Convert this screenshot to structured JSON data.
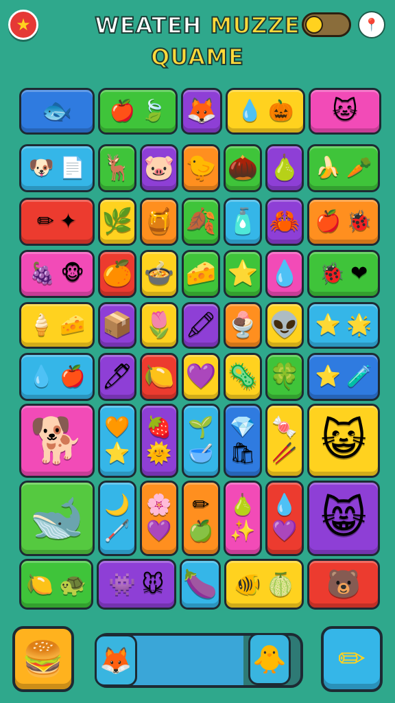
{
  "header": {
    "title_line1_part1": "WEATEH",
    "title_line1_part2": "MUZZE",
    "title_line2": "QUAME",
    "star_icon": "★",
    "pin_icon": "📍",
    "toggle_on": false
  },
  "palette": {
    "background": "#2fa88c",
    "blue": "#2f7be0",
    "green": "#3fc43a",
    "purple": "#8e3fd6",
    "yellow": "#ffd21f",
    "pink": "#f24bb7",
    "sky": "#35b6e8",
    "orange": "#ff8f1f",
    "red": "#ec3b2f",
    "lime": "#55c940"
  },
  "tiles": [
    {
      "name": "tile-robot-fish",
      "color": "blue",
      "items": [
        "🐟"
      ]
    },
    {
      "name": "tile-apple-leaf",
      "color": "green",
      "items": [
        "🍎",
        "🍃"
      ]
    },
    {
      "name": "tile-fox",
      "color": "purple",
      "items": [
        "🦊"
      ]
    },
    {
      "name": "tile-drop-pumpkin",
      "color": "yellow",
      "items": [
        "💧",
        "🎃"
      ]
    },
    {
      "name": "tile-cat",
      "color": "pink",
      "items": [
        "🐱"
      ]
    },
    {
      "name": "tile-dog-paper",
      "color": "sky",
      "items": [
        "🐶",
        "📄"
      ]
    },
    {
      "name": "tile-deer",
      "color": "green",
      "items": [
        "🦌"
      ]
    },
    {
      "name": "tile-pig",
      "color": "purple",
      "items": [
        "🐷"
      ]
    },
    {
      "name": "tile-chick",
      "color": "orange",
      "items": [
        "🐤"
      ]
    },
    {
      "name": "tile-pinecone",
      "color": "green",
      "items": [
        "🌰"
      ]
    },
    {
      "name": "tile-pear",
      "color": "purple",
      "items": [
        "🍐"
      ]
    },
    {
      "name": "tile-banana-carrot",
      "color": "green",
      "items": [
        "🍌",
        "🥕"
      ]
    },
    {
      "name": "tile-pencil-star",
      "color": "red",
      "items": [
        "✏",
        "✦"
      ]
    },
    {
      "name": "tile-herb",
      "color": "yellow",
      "items": [
        "🌿"
      ]
    },
    {
      "name": "tile-jar",
      "color": "orange",
      "items": [
        "🍯"
      ]
    },
    {
      "name": "tile-leaf",
      "color": "green",
      "items": [
        "🍂"
      ]
    },
    {
      "name": "tile-bottle",
      "color": "sky",
      "items": [
        "🧴"
      ]
    },
    {
      "name": "tile-crab",
      "color": "purple",
      "items": [
        "🦀"
      ]
    },
    {
      "name": "tile-apple-bug",
      "color": "orange",
      "items": [
        "🍎",
        "🐞"
      ]
    },
    {
      "name": "tile-grape-monkey",
      "color": "pink",
      "items": [
        "🍇",
        "🐵"
      ]
    },
    {
      "name": "tile-orange",
      "color": "red",
      "items": [
        "🍊"
      ]
    },
    {
      "name": "tile-pot",
      "color": "yellow",
      "items": [
        "🍲"
      ]
    },
    {
      "name": "tile-cheese",
      "color": "green",
      "items": [
        "🧀"
      ]
    },
    {
      "name": "tile-starfish",
      "color": "green",
      "items": [
        "⭐"
      ]
    },
    {
      "name": "tile-drop-purple",
      "color": "pink",
      "items": [
        "💧"
      ]
    },
    {
      "name": "tile-bug-heart",
      "color": "green",
      "items": [
        "🐞",
        "❤"
      ]
    },
    {
      "name": "tile-cone-cheese",
      "color": "yellow",
      "items": [
        "🍦",
        "🧀"
      ]
    },
    {
      "name": "tile-box",
      "color": "purple",
      "items": [
        "📦"
      ]
    },
    {
      "name": "tile-flowerpot",
      "color": "yellow",
      "items": [
        "🌷"
      ]
    },
    {
      "name": "tile-crayon",
      "color": "purple",
      "items": [
        "🖍"
      ]
    },
    {
      "name": "tile-cone",
      "color": "orange",
      "items": [
        "🍨"
      ]
    },
    {
      "name": "tile-alien",
      "color": "yellow",
      "items": [
        "👽"
      ]
    },
    {
      "name": "tile-stars",
      "color": "sky",
      "items": [
        "⭐",
        "🌟"
      ]
    },
    {
      "name": "tile-drop-apple",
      "color": "sky",
      "items": [
        "💧",
        "🍎"
      ]
    },
    {
      "name": "tile-marker",
      "color": "purple",
      "items": [
        "🖊"
      ]
    },
    {
      "name": "tile-lemon",
      "color": "red",
      "items": [
        "🍋"
      ]
    },
    {
      "name": "tile-heart-gem",
      "color": "yellow",
      "items": [
        "💜"
      ]
    },
    {
      "name": "tile-germ",
      "color": "yellow",
      "items": [
        "🦠"
      ]
    },
    {
      "name": "tile-leaf-green",
      "color": "green",
      "items": [
        "🍀"
      ]
    },
    {
      "name": "tile-star-flask",
      "color": "blue",
      "items": [
        "⭐",
        "🧪"
      ]
    }
  ],
  "big_tiles": [
    {
      "name": "tile-dog-big",
      "color": "pink",
      "items": [
        "🐕"
      ]
    },
    {
      "name": "tile-heart-star",
      "color": "sky",
      "items": [
        "🧡",
        "⭐"
      ]
    },
    {
      "name": "tile-strawberry-sun",
      "color": "purple",
      "items": [
        "🍓",
        "🌞"
      ]
    },
    {
      "name": "tile-leaf-bowl",
      "color": "sky",
      "items": [
        "🌱",
        "🥣"
      ]
    },
    {
      "name": "tile-gem-bag",
      "color": "blue",
      "items": [
        "💎",
        "🛍"
      ]
    },
    {
      "name": "tile-candy-stick",
      "color": "yellow",
      "items": [
        "🍬",
        "🥢"
      ]
    },
    {
      "name": "tile-cat-big",
      "color": "yellow",
      "items": [
        "😺"
      ]
    },
    {
      "name": "tile-whale",
      "color": "lime",
      "items": [
        "🐋"
      ]
    },
    {
      "name": "tile-banana-stick",
      "color": "sky",
      "items": [
        "🌙",
        "🦯"
      ]
    },
    {
      "name": "tile-flower-heart",
      "color": "orange",
      "items": [
        "🌸",
        "💜"
      ]
    },
    {
      "name": "tile-pencil-apple",
      "color": "orange",
      "items": [
        "✏",
        "🍏"
      ]
    },
    {
      "name": "tile-pear-star",
      "color": "pink",
      "items": [
        "🍐",
        "✨"
      ]
    },
    {
      "name": "tile-drop-heart",
      "color": "red",
      "items": [
        "💧",
        "💜"
      ]
    },
    {
      "name": "tile-cat-pink",
      "color": "purple",
      "items": [
        "😸"
      ]
    }
  ],
  "last_row": [
    {
      "name": "tile-lemon-turtle",
      "color": "green",
      "items": [
        "🍋",
        "🐢"
      ]
    },
    {
      "name": "tile-monster",
      "color": "purple",
      "items": [
        "👾",
        "🐭"
      ]
    },
    {
      "name": "tile-eggplant",
      "color": "sky",
      "items": [
        "🍆"
      ]
    },
    {
      "name": "tile-fish-lime",
      "color": "yellow",
      "items": [
        "🐠",
        "🍈"
      ]
    },
    {
      "name": "tile-bear",
      "color": "red",
      "items": [
        "🐻"
      ]
    }
  ],
  "bottom": {
    "left_button_icon": "🍔",
    "right_button_icon": "✏",
    "avatar_left_icon": "🦊",
    "avatar_right_icon": "🐥",
    "progress": 0.72
  }
}
